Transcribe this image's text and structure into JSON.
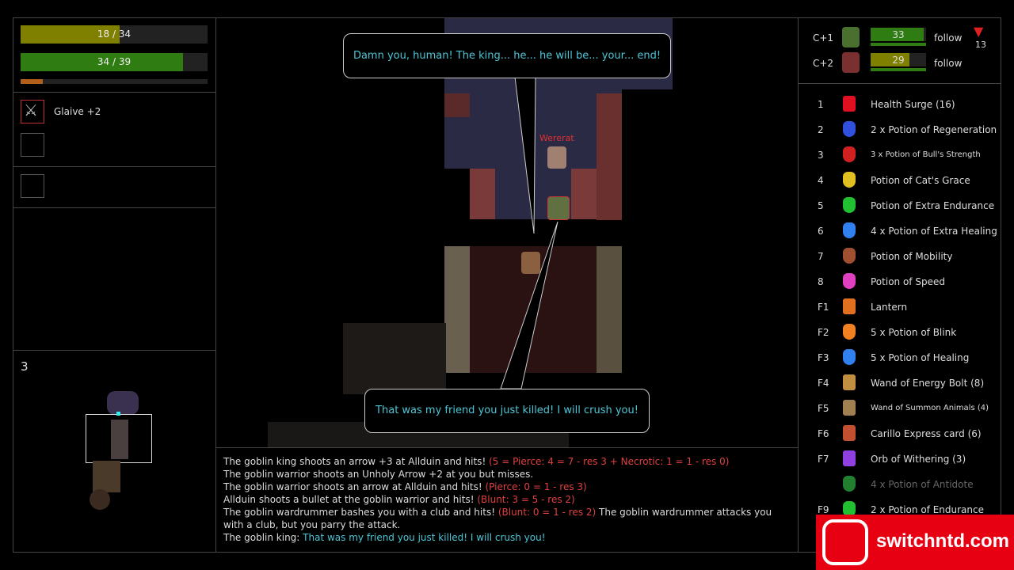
{
  "player": {
    "hp": {
      "text": "18 / 34",
      "fraction": 0.53,
      "color": "#808000"
    },
    "stamina": {
      "text": "34 / 39",
      "fraction": 0.87,
      "color": "#2f7d12"
    },
    "xp": {
      "fraction": 0.12,
      "color": "#b0601a"
    }
  },
  "equipment": {
    "weapon": "Glaive +2"
  },
  "minimap": {
    "level": "3"
  },
  "map": {
    "enemy_label": "Wererat",
    "speech_top": "Damn you, human! The king... he... he will be... your... end!",
    "speech_bottom": "That was my friend you just killed! I will crush you!"
  },
  "allies": [
    {
      "key": "C+1",
      "hp": "33",
      "hp_fraction": 0.95,
      "hp_color": "#2f7d12",
      "order": "follow"
    },
    {
      "key": "C+2",
      "hp": "29",
      "hp_fraction": 0.7,
      "hp_color": "#808000",
      "order": "follow"
    }
  ],
  "depth_indicator": {
    "icon": "down-arrow-icon",
    "value": "13"
  },
  "hotbar": [
    {
      "key": "1",
      "label": "Health Surge (16)",
      "icon": "heart-icon",
      "color": "#e01020"
    },
    {
      "key": "2",
      "label": "2 x Potion of Regeneration",
      "icon": "potion-icon",
      "color": "#3050e0"
    },
    {
      "key": "3",
      "label": "3 x Potion of Bull's Strength",
      "icon": "potion-icon",
      "color": "#d02020",
      "small": true
    },
    {
      "key": "4",
      "label": "Potion of Cat's Grace",
      "icon": "potion-icon",
      "color": "#e0c020"
    },
    {
      "key": "5",
      "label": "Potion of Extra Endurance",
      "icon": "potion-icon",
      "color": "#20c030"
    },
    {
      "key": "6",
      "label": "4 x Potion of Extra Healing",
      "icon": "potion-icon",
      "color": "#3080f0"
    },
    {
      "key": "7",
      "label": "Potion of Mobility",
      "icon": "potion-icon",
      "color": "#a05030"
    },
    {
      "key": "8",
      "label": "Potion of Speed",
      "icon": "potion-icon",
      "color": "#e040c0"
    },
    {
      "key": "F1",
      "label": "Lantern",
      "icon": "lantern-icon",
      "color": "#e07020"
    },
    {
      "key": "F2",
      "label": "5 x Potion of Blink",
      "icon": "potion-icon",
      "color": "#f08020"
    },
    {
      "key": "F3",
      "label": "5 x Potion of Healing",
      "icon": "potion-icon",
      "color": "#3080f0"
    },
    {
      "key": "F4",
      "label": "Wand of Energy Bolt (8)",
      "icon": "wand-icon",
      "color": "#c09040"
    },
    {
      "key": "F5",
      "label": "Wand of Summon Animals (4)",
      "icon": "wand-icon",
      "color": "#a08050",
      "small": true
    },
    {
      "key": "F6",
      "label": "Carillo Express card (6)",
      "icon": "card-icon",
      "color": "#c05030"
    },
    {
      "key": "F7",
      "label": "Orb of Withering (3)",
      "icon": "orb-icon",
      "color": "#9040e0"
    },
    {
      "key": "",
      "label": "4 x Potion of Antidote",
      "icon": "potion-icon",
      "color": "#208030",
      "disabled": true
    },
    {
      "key": "F9",
      "label": "2 x Potion of Endurance",
      "icon": "potion-icon",
      "color": "#20c030"
    }
  ],
  "log": [
    [
      {
        "t": "The goblin king shoots an arrow +3 at Allduin and hits! ",
        "c": ""
      },
      {
        "t": "(5 = Pierce: 4 = 7 - res 3 + Necrotic: 1 = 1 - res 0)",
        "c": "red"
      }
    ],
    [
      {
        "t": "The goblin warrior shoots an Unholy Arrow +2 at you but misses.",
        "c": ""
      }
    ],
    [
      {
        "t": "The goblin warrior shoots an arrow at Allduin and hits! ",
        "c": ""
      },
      {
        "t": "(Pierce: 0 = 1 - res 3)",
        "c": "red"
      }
    ],
    [
      {
        "t": "Allduin shoots a bullet at the goblin warrior and hits! ",
        "c": ""
      },
      {
        "t": "(Blunt: 3 = 5 - res 2)",
        "c": "red"
      }
    ],
    [
      {
        "t": "The goblin wardrummer bashes you with a club and hits! ",
        "c": ""
      },
      {
        "t": "(Blunt: 0 = 1 - res 2)",
        "c": "red"
      },
      {
        "t": " The goblin wardrummer attacks you with a club, but you parry the attack.",
        "c": ""
      }
    ],
    [
      {
        "t": "The goblin king: ",
        "c": ""
      },
      {
        "t": "That was my friend you just killed! I will crush you!",
        "c": "cyan"
      }
    ]
  ],
  "watermark": "switchntd.com"
}
